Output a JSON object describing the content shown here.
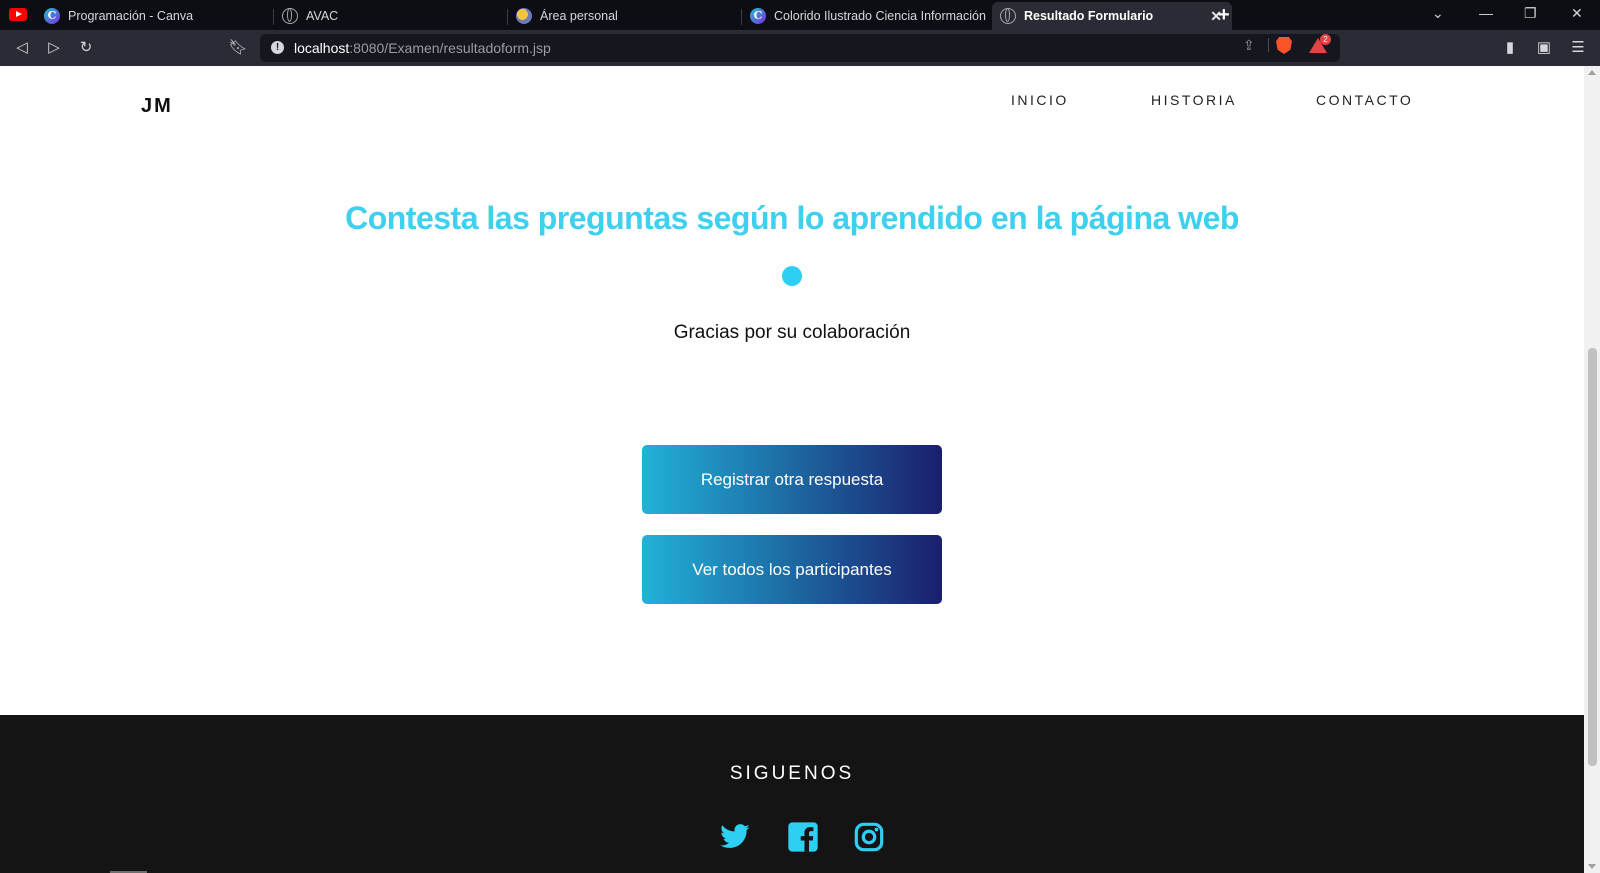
{
  "browser": {
    "tabs": [
      {
        "label": "Programación - Canva",
        "icon": "canva-icon"
      },
      {
        "label": "AVAC",
        "icon": "globe-icon"
      },
      {
        "label": "Área personal",
        "icon": "moodle-icon"
      },
      {
        "label": "Colorido Ilustrado Ciencia Información",
        "icon": "canva-icon"
      },
      {
        "label": "Resultado Formulario",
        "icon": "globe-icon"
      }
    ],
    "url_host": "localhost",
    "url_rest": ":8080/Examen/resultadoform.jsp",
    "rewards_badge": "2"
  },
  "page": {
    "logo": "JM",
    "nav": [
      "INICIO",
      "HISTORIA",
      "CONTACTO"
    ],
    "heading": "Contesta las preguntas según lo aprendido en la página web",
    "message": "Gracias por su colaboración",
    "buttons": {
      "register": "Registrar otra respuesta",
      "view_all": "Ver todos los participantes"
    },
    "footer": {
      "title": "SIGUENOS",
      "social": [
        "twitter-icon",
        "facebook-icon",
        "instagram-icon"
      ]
    },
    "colors": {
      "accent": "#3fd0f0",
      "button_gradient_start": "#21b2d7",
      "button_gradient_end": "#1a1f6d",
      "footer_bg": "#141414"
    }
  }
}
